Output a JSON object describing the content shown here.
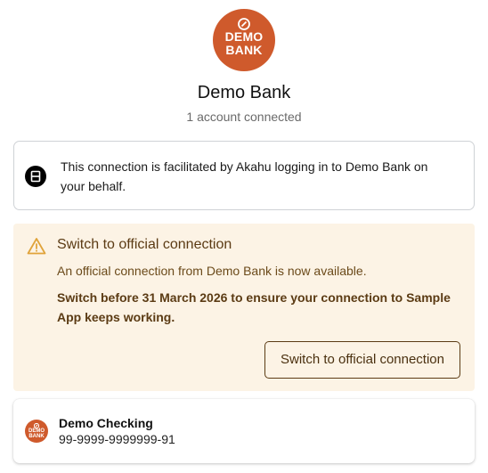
{
  "bank": {
    "logo_line1": "DEMO",
    "logo_line2": "BANK",
    "name": "Demo Bank",
    "accounts_connected": "1 account connected",
    "brand_color": "#cf5a2c"
  },
  "info": {
    "icon": "akahu-icon",
    "text": "This connection is facilitated by Akahu logging in to Demo Bank on your behalf."
  },
  "warning": {
    "icon": "warning-triangle-icon",
    "title": "Switch to official connection",
    "body": "An official connection from Demo Bank is now available.",
    "deadline_notice": "Switch before 31 March 2026 to ensure your connection to Sample App keeps working.",
    "button_label": "Switch to official connection",
    "background_color": "#fcf3e5",
    "accent_color": "#e0a33a"
  },
  "account": {
    "logo_line1": "DEMO",
    "logo_line2": "BANK",
    "name": "Demo Checking",
    "number": "99-9999-9999999-91"
  }
}
